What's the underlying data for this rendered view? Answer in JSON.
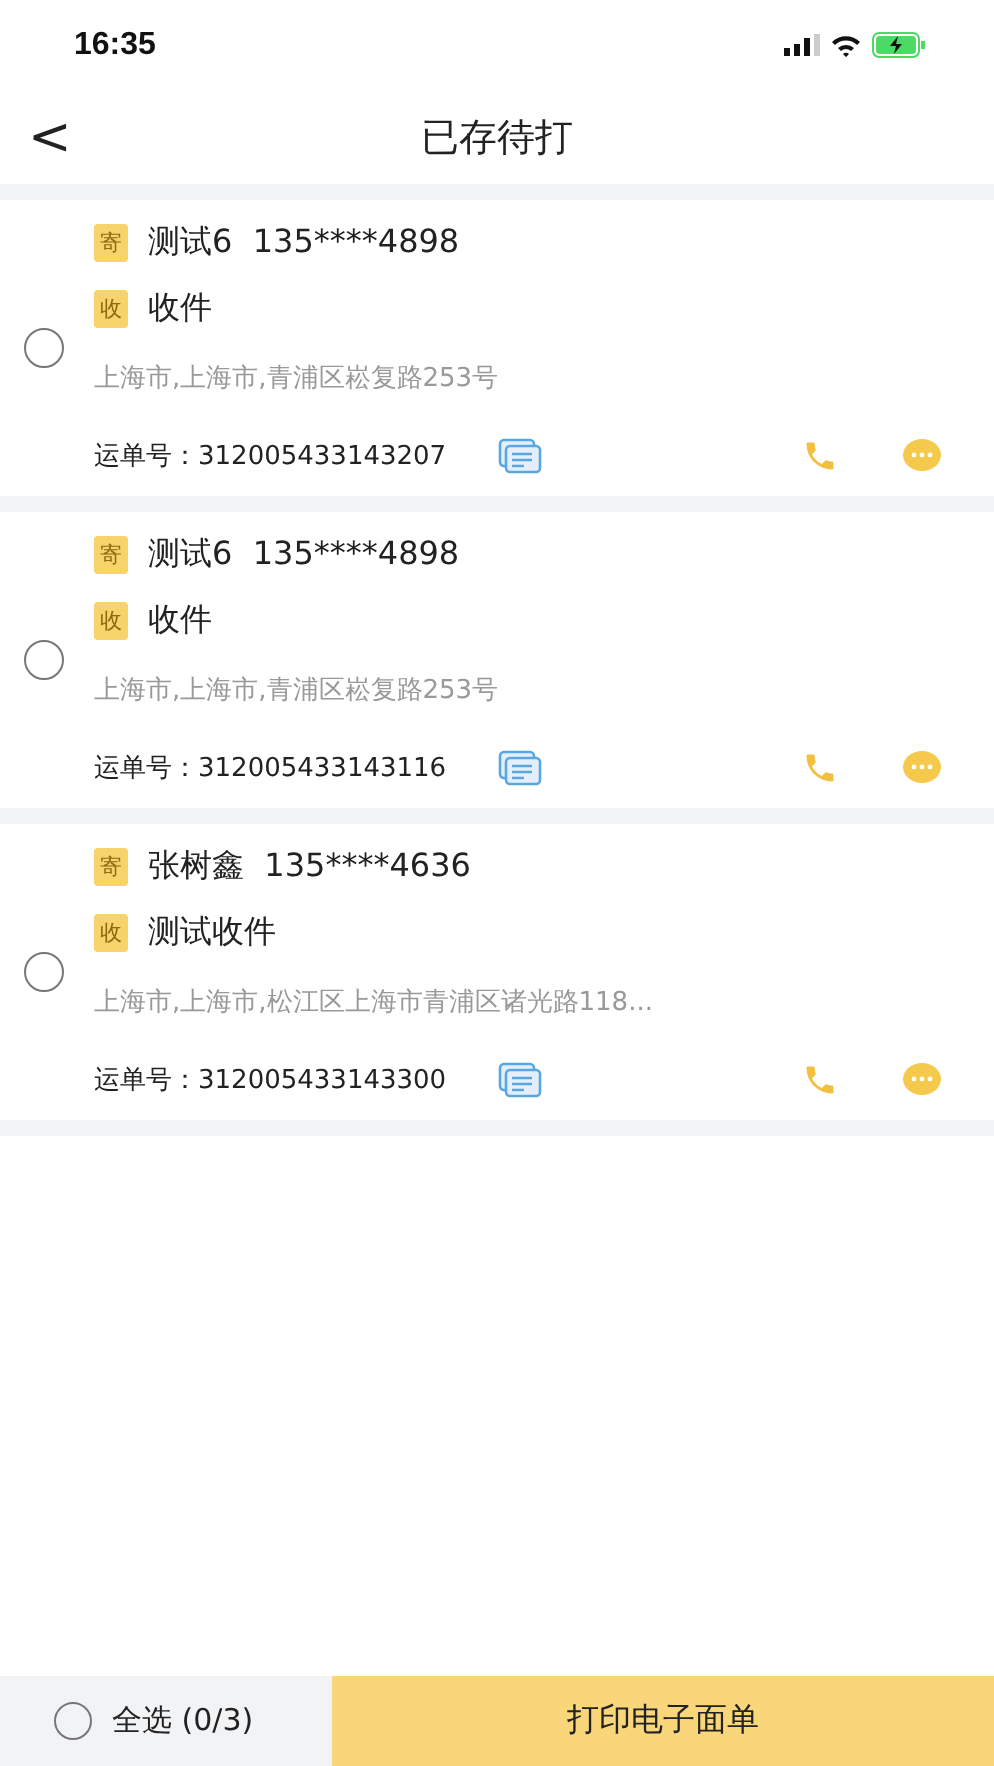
{
  "status_bar": {
    "time": "16:35"
  },
  "nav": {
    "back": "<",
    "title": "已存待打"
  },
  "orders": [
    {
      "selected": false,
      "sender_tag": "寄",
      "sender": "测试6  135****4898",
      "receiver_tag": "收",
      "receiver": "收件",
      "address": "上海市,上海市,青浦区崧复路253号",
      "waybill_label": "运单号：",
      "waybill": "312005433143207"
    },
    {
      "selected": false,
      "sender_tag": "寄",
      "sender": "测试6  135****4898",
      "receiver_tag": "收",
      "receiver": "收件",
      "address": "上海市,上海市,青浦区崧复路253号",
      "waybill_label": "运单号：",
      "waybill": "312005433143116"
    },
    {
      "selected": false,
      "sender_tag": "寄",
      "sender": "张树鑫  135****4636",
      "receiver_tag": "收",
      "receiver": "测试收件",
      "address": "上海市,上海市,松江区上海市青浦区诸光路118...",
      "waybill_label": "运单号：",
      "waybill": "312005433143300"
    }
  ],
  "footer": {
    "select_all": {
      "label": "全选 (0/3)",
      "selected": false
    },
    "print_button": "打印电子面单"
  }
}
